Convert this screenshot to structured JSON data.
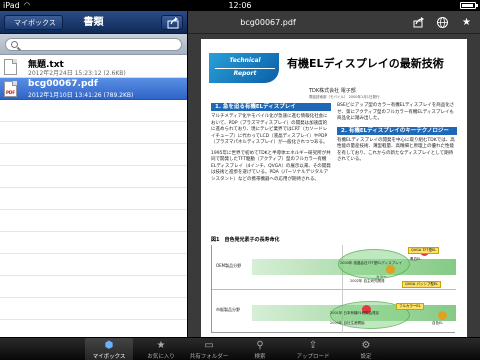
{
  "status": {
    "carrier": "iPad",
    "time": "12:06"
  },
  "sidebar": {
    "back_label": "マイボックス",
    "title": "書類",
    "search_placeholder": "",
    "files": [
      {
        "name": "無題.txt",
        "meta": "2012年2月24日 15:23:12 (2.6KB)",
        "type": "txt",
        "selected": false
      },
      {
        "name": "bcg00067.pdf",
        "meta": "2012年1月10日 13:41:26 (789.2KB)",
        "type": "pdf",
        "selected": true
      }
    ]
  },
  "viewer": {
    "title": "bcg00067.pdf",
    "icons": [
      "share-icon",
      "globe-icon",
      "bookmark-star-icon"
    ]
  },
  "document": {
    "tag_line1": "Technical",
    "tag_line2": "Report",
    "heading": "有機ELディスプレイの最新技術",
    "byline": "TDK株式会社 電子部",
    "byline_sub": "電話技術部（モバイル） 2000年1月1日発行",
    "section1": "1. 急を迫る有機ELディスプレイ",
    "section2": "2. 有機ELディスプレイのキーテクノロジー",
    "para_l1": "マルチメディア化やモバイル化が急速に進む情報化社会において、PDP（プラズマディスプレイ）の開発は加速度的に進められており、現にテレビ業界ではCRT（カソードレイチューブ）に代わってLCD（液晶ディスプレイ）やPDP（プラズマパネルディスプレイ）が一般化されつつある。",
    "para_l2": "1995年に世界で初めてTDKと半導体エネルギー研究所が共同で開発したTFT駆動（アクティブ）型のフルカラー有機ELディスプレイ（4インチ、QVGA）の展示以来、その開発は技術と進歩を遂げている。PDA（パーソナルデジタルアシスタント）などの携帯機器への応用が期待される。",
    "para_r1": "BSEビにアップ型のカラー有機ELディスプレイを商品化させ、第にアクティブ型のフルカラー有機ELディスプレイも商品化に踏み出した。",
    "para_r2": "有機ELディスプレイの開発を中心に取り組むTDKでは、高性能の量産技術、薄型軽量、高精細と原理上の優れた性能を有しており、これからの新たなディスプレイとして期待されている。",
    "fig_title": "図1　自色発光素子の長寿命化",
    "fig_row1": "OEM製品分野",
    "fig_row2": "市販製品分野",
    "fig_labels": [
      "2000年 液晶会社TFT型ELディスプレイ",
      "2002年 自主研究開発",
      "2001年 日本有機EL研究会発足",
      "2003年 自社生産開始"
    ],
    "fig_pills": [
      "QVGA TFT型EL",
      "QVGA パッシブ型EL",
      "フルカラーEL"
    ],
    "fig_dots": [
      "黒白EL",
      "カラー",
      "自色EL"
    ]
  },
  "tabbar": {
    "items": [
      {
        "label": "マイボックス",
        "icon": "mybox-icon",
        "active": true
      },
      {
        "label": "お気に入り",
        "icon": "star-icon",
        "active": false
      },
      {
        "label": "共有フォルダー",
        "icon": "shared-folder-icon",
        "active": false
      },
      {
        "label": "検索",
        "icon": "search-icon",
        "active": false
      },
      {
        "label": "アップロード",
        "icon": "upload-icon",
        "active": false
      },
      {
        "label": "設定",
        "icon": "settings-icon",
        "active": false
      }
    ]
  },
  "colors": {
    "toolbar_blue": "#1b3a70",
    "selection_blue": "#3a74d4",
    "section_blue": "#1e68b7"
  }
}
